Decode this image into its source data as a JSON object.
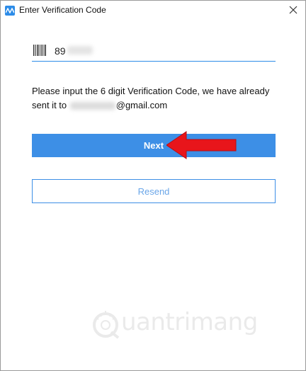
{
  "window": {
    "title": "Enter Verification Code",
    "app_icon": "app-logo-icon",
    "close_icon": "close-icon"
  },
  "code_field": {
    "icon": "barcode-icon",
    "value": "89"
  },
  "message": {
    "line_start": "Please input the 6 digit Verification Code, we have already sent it to ",
    "email_domain": "@gmail.com"
  },
  "buttons": {
    "next_label": "Next",
    "resend_label": "Resend"
  },
  "annotation": {
    "arrow_color": "#e8151b",
    "icon": "red-arrow-icon"
  },
  "watermark": {
    "text": "uantrimang"
  },
  "colors": {
    "accent": "#3d8fe6",
    "resend_text": "#6aa6e8"
  }
}
